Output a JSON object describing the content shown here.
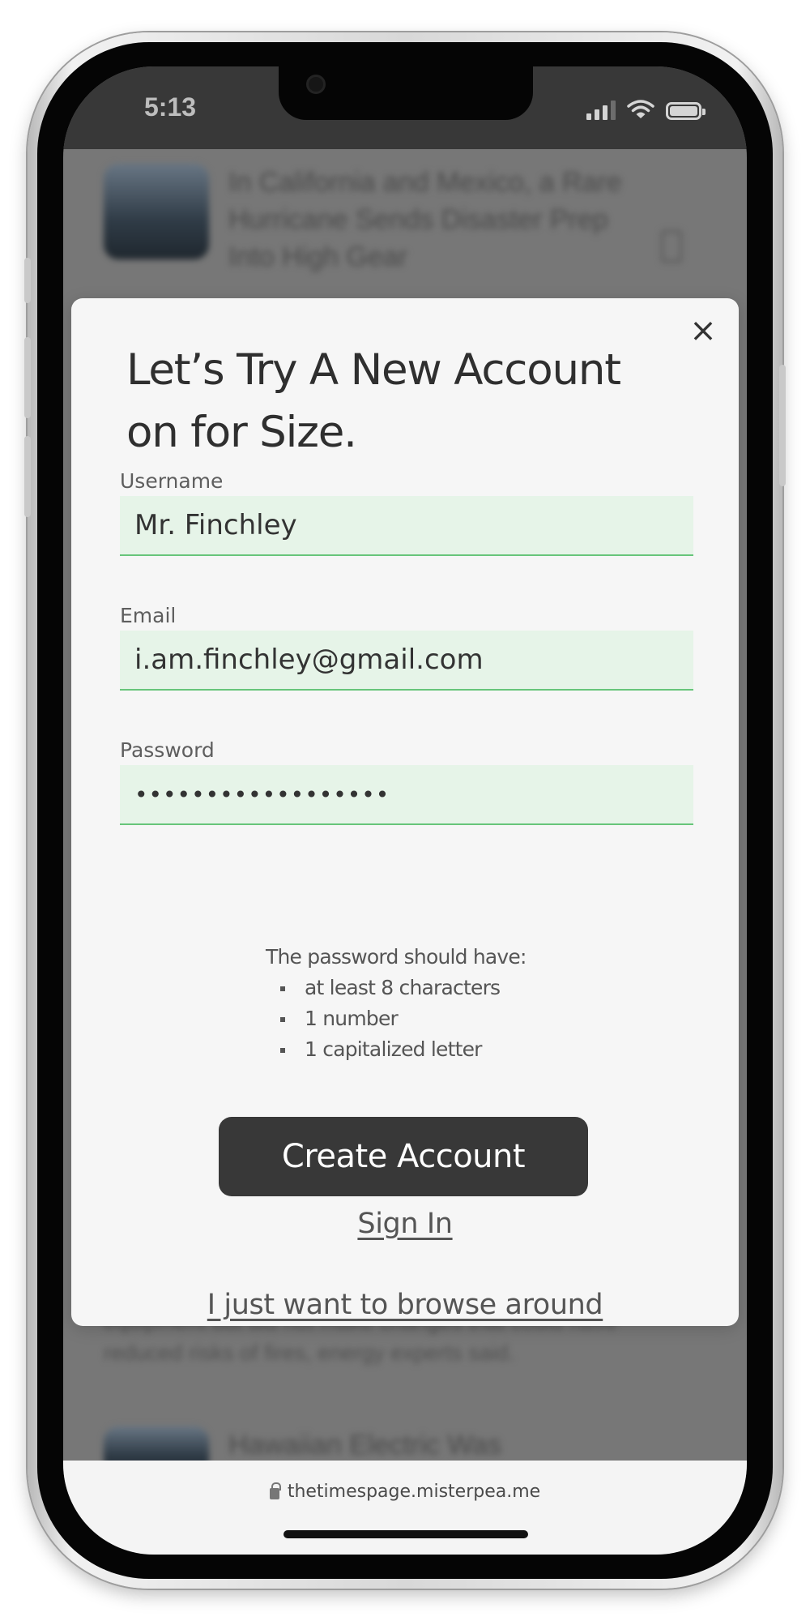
{
  "status_bar": {
    "time": "5:13"
  },
  "background": {
    "article_1_title": "In California and Mexico, a Rare Hurricane Sends Disaster Prep Into High Gear",
    "snippet": "equipment but did not make changes that could have reduced risks of fires, energy experts said.",
    "article_2_title": "Hawaiian Electric Was"
  },
  "modal": {
    "title": "Let’s Try A New Account on for Size.",
    "close_icon": "×",
    "fields": [
      {
        "label": "Username",
        "value": "Mr. Finchley"
      },
      {
        "label": "Email",
        "value": "i.am.finchley@gmail.com"
      },
      {
        "label": "Password",
        "value": "••••••••••••••••••"
      }
    ],
    "password_rules": {
      "heading": "The password should have:",
      "items": [
        "at least 8 characters",
        "1 number",
        "1 capitalized letter"
      ]
    },
    "create_button": "Create Account",
    "sign_in_link": "Sign In",
    "browse_link": "I just want to browse around"
  },
  "url_bar": {
    "url": "thetimespage.misterpea.me"
  },
  "colors": {
    "input_bg": "#e6f4e8",
    "input_underline": "#67c57a",
    "button_bg": "#383838",
    "overlay": "#777777"
  }
}
